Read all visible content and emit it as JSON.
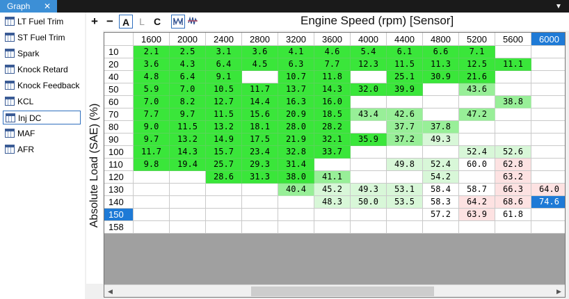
{
  "tab": {
    "title": "Graph",
    "close": "✕"
  },
  "dropdown_glyph": "▼",
  "sidebar": {
    "items": [
      {
        "label": "LT Fuel Trim",
        "icon": "table-icon"
      },
      {
        "label": "ST Fuel Trim",
        "icon": "table-icon"
      },
      {
        "label": "Spark",
        "icon": "table-icon"
      },
      {
        "label": "Knock Retard",
        "icon": "table-icon"
      },
      {
        "label": "Knock Feedback",
        "icon": "table-icon"
      },
      {
        "label": "KCL",
        "icon": "table-icon"
      },
      {
        "label": "Inj DC",
        "icon": "table-icon",
        "selected": true
      },
      {
        "label": "MAF",
        "icon": "table-icon"
      },
      {
        "label": "AFR",
        "icon": "table-icon"
      }
    ]
  },
  "toolbar": {
    "plus": "+",
    "minus": "−",
    "a": "A",
    "l": "L",
    "c": "C"
  },
  "axis_title": "Engine Speed (rpm) [Sensor]",
  "y_label": "Absolute Load (SAE) (%)",
  "colors": {
    "green": "#3ae63a",
    "light_green": "#98ef98",
    "very_light_green": "#d8f7d8",
    "pink": "#fde2e2",
    "selected": "#1e7ad6"
  },
  "table": {
    "columns": [
      "1600",
      "2000",
      "2400",
      "2800",
      "3200",
      "3600",
      "4000",
      "4400",
      "4800",
      "5200",
      "5600",
      "6000"
    ],
    "selected_column": 11,
    "selected_row": 13,
    "rows": [
      {
        "load": "10",
        "cells": [
          [
            "2.1",
            "g"
          ],
          [
            "2.5",
            "g"
          ],
          [
            "3.1",
            "g"
          ],
          [
            "3.6",
            "g"
          ],
          [
            "4.1",
            "g"
          ],
          [
            "4.6",
            "g"
          ],
          [
            "5.4",
            "g"
          ],
          [
            "6.1",
            "g"
          ],
          [
            "6.6",
            "g"
          ],
          [
            "7.1",
            "g"
          ],
          [
            "",
            ""
          ],
          [
            "",
            ""
          ]
        ]
      },
      {
        "load": "20",
        "cells": [
          [
            "3.6",
            "g"
          ],
          [
            "4.3",
            "g"
          ],
          [
            "6.4",
            "g"
          ],
          [
            "4.5",
            "g"
          ],
          [
            "6.3",
            "g"
          ],
          [
            "7.7",
            "g"
          ],
          [
            "12.3",
            "g"
          ],
          [
            "11.5",
            "g"
          ],
          [
            "11.3",
            "g"
          ],
          [
            "12.5",
            "g"
          ],
          [
            "11.1",
            "g"
          ],
          [
            "",
            ""
          ]
        ]
      },
      {
        "load": "40",
        "cells": [
          [
            "4.8",
            "g"
          ],
          [
            "6.4",
            "g"
          ],
          [
            "9.1",
            "g"
          ],
          [
            "",
            ""
          ],
          [
            "10.7",
            "g"
          ],
          [
            "11.8",
            "g"
          ],
          [
            "",
            ""
          ],
          [
            "25.1",
            "g"
          ],
          [
            "30.9",
            "g"
          ],
          [
            "21.6",
            "g"
          ],
          [
            "",
            ""
          ],
          [
            "",
            ""
          ]
        ]
      },
      {
        "load": "50",
        "cells": [
          [
            "5.9",
            "g"
          ],
          [
            "7.0",
            "g"
          ],
          [
            "10.5",
            "g"
          ],
          [
            "11.7",
            "g"
          ],
          [
            "13.7",
            "g"
          ],
          [
            "14.3",
            "g"
          ],
          [
            "32.0",
            "g"
          ],
          [
            "39.9",
            "g"
          ],
          [
            "",
            ""
          ],
          [
            "43.6",
            "lg"
          ],
          [
            "",
            ""
          ],
          [
            "",
            ""
          ]
        ]
      },
      {
        "load": "60",
        "cells": [
          [
            "7.0",
            "g"
          ],
          [
            "8.2",
            "g"
          ],
          [
            "12.7",
            "g"
          ],
          [
            "14.4",
            "g"
          ],
          [
            "16.3",
            "g"
          ],
          [
            "16.0",
            "g"
          ],
          [
            "",
            ""
          ],
          [
            "",
            ""
          ],
          [
            "",
            ""
          ],
          [
            "",
            ""
          ],
          [
            "38.8",
            "lg"
          ],
          [
            "",
            ""
          ]
        ]
      },
      {
        "load": "70",
        "cells": [
          [
            "7.7",
            "g"
          ],
          [
            "9.7",
            "g"
          ],
          [
            "11.5",
            "g"
          ],
          [
            "15.6",
            "g"
          ],
          [
            "20.9",
            "g"
          ],
          [
            "18.5",
            "g"
          ],
          [
            "43.4",
            "lg"
          ],
          [
            "42.6",
            "lg"
          ],
          [
            "",
            ""
          ],
          [
            "47.2",
            "lg"
          ],
          [
            "",
            ""
          ],
          [
            "",
            ""
          ]
        ]
      },
      {
        "load": "80",
        "cells": [
          [
            "9.0",
            "g"
          ],
          [
            "11.5",
            "g"
          ],
          [
            "13.2",
            "g"
          ],
          [
            "18.1",
            "g"
          ],
          [
            "28.0",
            "g"
          ],
          [
            "28.2",
            "g"
          ],
          [
            "",
            ""
          ],
          [
            "37.7",
            "lg"
          ],
          [
            "37.8",
            "lg"
          ],
          [
            "",
            ""
          ],
          [
            "",
            ""
          ],
          [
            "",
            ""
          ]
        ]
      },
      {
        "load": "90",
        "cells": [
          [
            "9.7",
            "g"
          ],
          [
            "13.2",
            "g"
          ],
          [
            "14.9",
            "g"
          ],
          [
            "17.5",
            "g"
          ],
          [
            "21.9",
            "g"
          ],
          [
            "32.1",
            "g"
          ],
          [
            "35.9",
            "g"
          ],
          [
            "37.2",
            "lg"
          ],
          [
            "49.3",
            "vlg"
          ],
          [
            "",
            ""
          ],
          [
            "",
            ""
          ],
          [
            "",
            ""
          ]
        ]
      },
      {
        "load": "100",
        "cells": [
          [
            "11.7",
            "g"
          ],
          [
            "14.3",
            "g"
          ],
          [
            "15.7",
            "g"
          ],
          [
            "23.4",
            "g"
          ],
          [
            "32.8",
            "g"
          ],
          [
            "33.7",
            "g"
          ],
          [
            "",
            ""
          ],
          [
            "",
            ""
          ],
          [
            "",
            ""
          ],
          [
            "52.4",
            "vlg"
          ],
          [
            "52.6",
            "vlg"
          ],
          [
            "",
            ""
          ]
        ]
      },
      {
        "load": "110",
        "cells": [
          [
            "9.8",
            "g"
          ],
          [
            "19.4",
            "g"
          ],
          [
            "25.7",
            "g"
          ],
          [
            "29.3",
            "g"
          ],
          [
            "31.4",
            "g"
          ],
          [
            "",
            ""
          ],
          [
            "",
            ""
          ],
          [
            "49.8",
            "vlg"
          ],
          [
            "52.4",
            "vlg"
          ],
          [
            "60.0",
            ""
          ],
          [
            "62.8",
            "pk"
          ],
          [
            "",
            ""
          ]
        ]
      },
      {
        "load": "120",
        "cells": [
          [
            "",
            ""
          ],
          [
            "",
            ""
          ],
          [
            "28.6",
            "g"
          ],
          [
            "31.3",
            "g"
          ],
          [
            "38.0",
            "g"
          ],
          [
            "41.1",
            "lg"
          ],
          [
            "",
            ""
          ],
          [
            "",
            ""
          ],
          [
            "54.2",
            "vlg"
          ],
          [
            "",
            ""
          ],
          [
            "63.2",
            "pk"
          ],
          [
            "",
            ""
          ]
        ]
      },
      {
        "load": "130",
        "cells": [
          [
            "",
            ""
          ],
          [
            "",
            ""
          ],
          [
            "",
            ""
          ],
          [
            "",
            ""
          ],
          [
            "40.4",
            "lg"
          ],
          [
            "45.2",
            "vlg"
          ],
          [
            "49.3",
            "vlg"
          ],
          [
            "53.1",
            "vlg"
          ],
          [
            "58.4",
            ""
          ],
          [
            "58.7",
            ""
          ],
          [
            "66.3",
            "pk"
          ],
          [
            "64.0",
            "pk"
          ]
        ]
      },
      {
        "load": "140",
        "cells": [
          [
            "",
            ""
          ],
          [
            "",
            ""
          ],
          [
            "",
            ""
          ],
          [
            "",
            ""
          ],
          [
            "",
            ""
          ],
          [
            "48.3",
            "vlg"
          ],
          [
            "50.0",
            "vlg"
          ],
          [
            "53.5",
            "vlg"
          ],
          [
            "58.3",
            ""
          ],
          [
            "64.2",
            "pk"
          ],
          [
            "68.6",
            "pk"
          ],
          [
            "74.6",
            "sel"
          ]
        ]
      },
      {
        "load": "150",
        "cells": [
          [
            "",
            ""
          ],
          [
            "",
            ""
          ],
          [
            "",
            ""
          ],
          [
            "",
            ""
          ],
          [
            "",
            ""
          ],
          [
            "",
            ""
          ],
          [
            "",
            ""
          ],
          [
            "",
            ""
          ],
          [
            "57.2",
            ""
          ],
          [
            "63.9",
            "pk"
          ],
          [
            "61.8",
            ""
          ],
          [
            "",
            ""
          ]
        ]
      },
      {
        "load": "158",
        "cells": [
          [
            "",
            ""
          ],
          [
            "",
            ""
          ],
          [
            "",
            ""
          ],
          [
            "",
            ""
          ],
          [
            "",
            ""
          ],
          [
            "",
            ""
          ],
          [
            "",
            ""
          ],
          [
            "",
            ""
          ],
          [
            "",
            ""
          ],
          [
            "",
            ""
          ],
          [
            "",
            ""
          ],
          [
            "",
            ""
          ]
        ]
      }
    ]
  },
  "scrollbar": {
    "left": "◀",
    "right": "▶"
  }
}
